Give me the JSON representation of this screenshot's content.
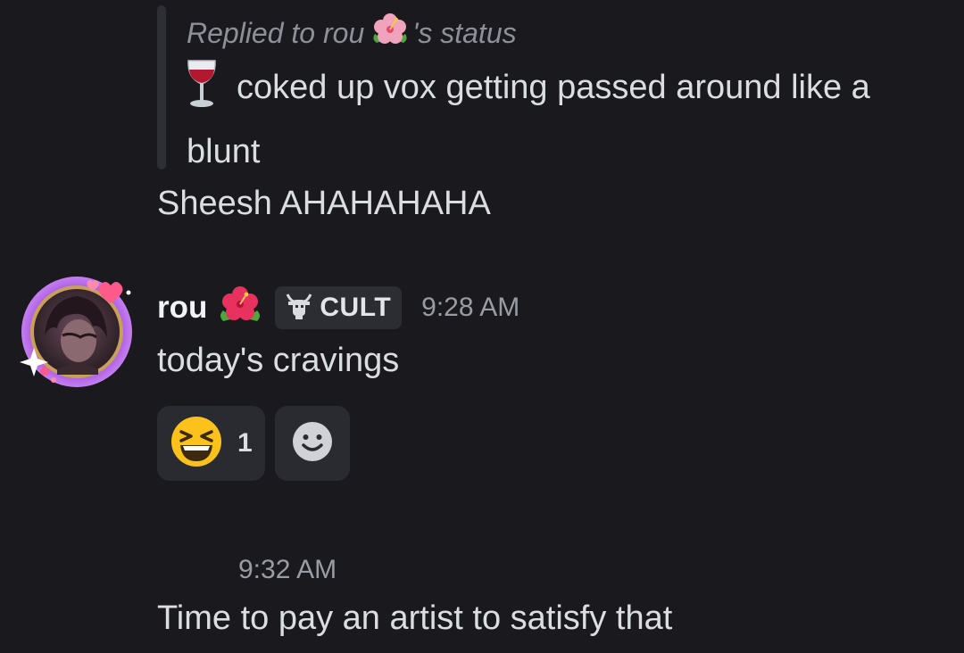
{
  "reply": {
    "header_prefix": "Replied to rou",
    "header_suffix": "'s status",
    "status_text": "coked up vox getting passed around like a blunt",
    "status_icon": "wine-glass-icon"
  },
  "messages": [
    {
      "text": "Sheesh AHAHAHAHA"
    }
  ],
  "author": {
    "name": "rou",
    "name_icon": "hibiscus-icon",
    "tag_label": "CULT",
    "tag_icon": "goat-icon",
    "timestamp": "9:28 AM",
    "message": "today's cravings"
  },
  "reactions": [
    {
      "emoji": "laughing-face-icon",
      "count": "1"
    },
    {
      "emoji": "add-reaction-icon"
    }
  ],
  "followup": {
    "timestamp": "9:32 AM",
    "message": "Time to pay an artist to satisfy that"
  },
  "colors": {
    "background": "#1a1a1e",
    "text": "#dbdee1",
    "muted": "#9a9ca4",
    "chip": "#2a2b30"
  }
}
